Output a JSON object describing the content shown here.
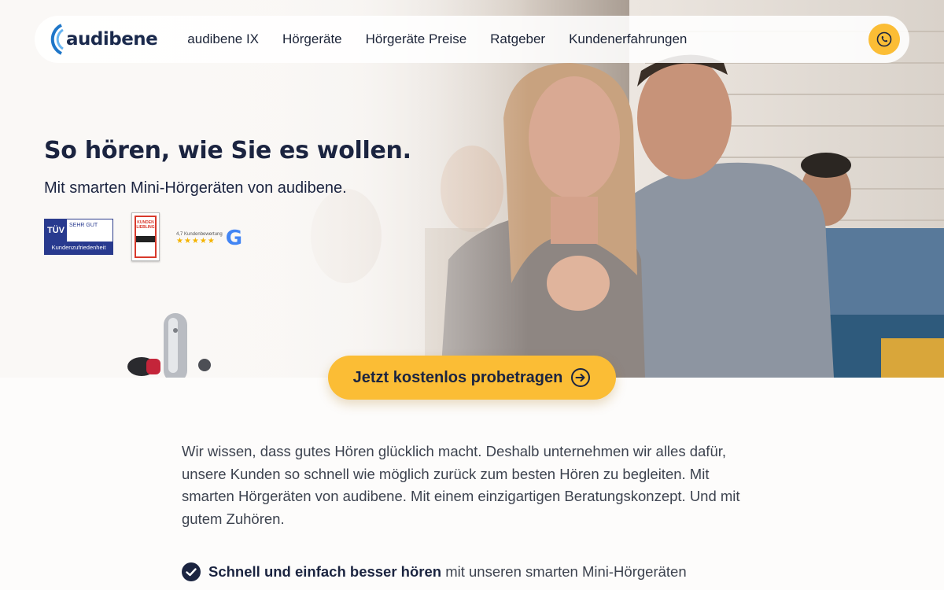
{
  "brand": {
    "name": "audibene"
  },
  "nav": {
    "items": [
      {
        "label": "audibene IX"
      },
      {
        "label": "Hörgeräte"
      },
      {
        "label": "Hörgeräte Preise"
      },
      {
        "label": "Ratgeber"
      },
      {
        "label": "Kundenerfahrungen"
      }
    ],
    "phone_icon": "phone-icon"
  },
  "hero": {
    "title": "So hören, wie Sie es wollen.",
    "subtitle": "Mit smarten Mini-Hörgeräten von audibene.",
    "cta_label": "Jetzt kostenlos probetragen",
    "cta_icon": "arrow-right-circle-icon"
  },
  "badges": {
    "tuv": {
      "logo": "TÜV",
      "grade": "SEHR GUT",
      "label": "Kundenzufriedenheit"
    },
    "kunden": {
      "title": "KUNDEN LIEBLING"
    },
    "google": {
      "label": "4,7 Kundenbewertung",
      "stars": "★★★★★",
      "logo": "G"
    }
  },
  "intro_text": "Wir wissen, dass gutes Hören glücklich macht. Deshalb unternehmen wir alles dafür, unsere Kunden so schnell wie möglich zurück zum besten Hören zu begleiten. Mit smarten Hörgeräten von audibene. Mit einem einzigartigen Beratungskonzept. Und mit gutem Zuhören.",
  "features": [
    {
      "bold": "Schnell und einfach besser hören",
      "rest": " mit unseren smarten Mini-Hörgeräten"
    }
  ],
  "colors": {
    "accent": "#fbbd35",
    "navy": "#1b2440",
    "body_text": "#3d434f"
  }
}
